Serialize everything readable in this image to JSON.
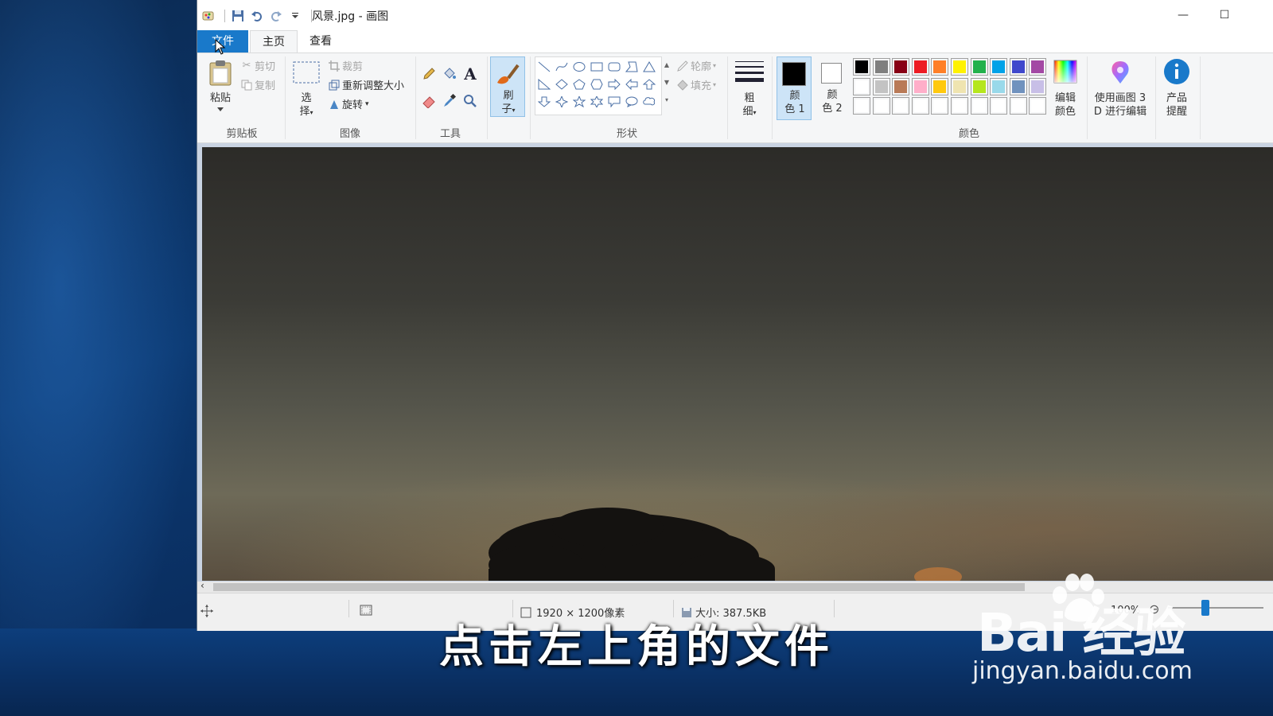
{
  "window": {
    "title": "风景.jpg - 画图",
    "controls": {
      "minimize": "—",
      "maximize": "☐"
    }
  },
  "tabs": [
    {
      "label": "文件",
      "active": true
    },
    {
      "label": "主页"
    },
    {
      "label": "查看"
    }
  ],
  "ribbon": {
    "clipboard": {
      "paste": "粘贴",
      "cut": "剪切",
      "copy": "复制",
      "group": "剪贴板"
    },
    "image": {
      "select_1": "选",
      "select_2": "择",
      "crop": "裁剪",
      "resize": "重新调整大小",
      "rotate": "旋转",
      "group": "图像"
    },
    "tools": {
      "group": "工具"
    },
    "brush": {
      "label_1": "刷",
      "label_2": "子"
    },
    "shapes": {
      "outline": "轮廓",
      "fill": "填充",
      "group": "形状"
    },
    "size": {
      "label_1": "粗",
      "label_2": "细"
    },
    "color1": {
      "label_1": "颜",
      "label_2": "色 1",
      "value": "#000000"
    },
    "color2": {
      "label_1": "颜",
      "label_2": "色 2",
      "value": "#ffffff"
    },
    "colors": {
      "group": "颜色",
      "row1": [
        "#000000",
        "#7f7f7f",
        "#880015",
        "#ed1c24",
        "#ff7f27",
        "#fff200",
        "#22b14c",
        "#00a2e8",
        "#3f48cc",
        "#a349a4"
      ],
      "row2": [
        "#ffffff",
        "#c3c3c3",
        "#b97a57",
        "#ffaec9",
        "#ffc90e",
        "#efe4b0",
        "#b5e61d",
        "#99d9ea",
        "#7092be",
        "#c8bfe7"
      ],
      "row3": [
        "#ffffff",
        "#ffffff",
        "#ffffff",
        "#ffffff",
        "#ffffff",
        "#ffffff",
        "#ffffff",
        "#ffffff",
        "#ffffff",
        "#ffffff"
      ]
    },
    "edit_colors": {
      "label_1": "编辑",
      "label_2": "颜色"
    },
    "paint3d": {
      "label_1": "使用画图 3",
      "label_2": "D 进行编辑"
    },
    "product_alert": {
      "label_1": "产品",
      "label_2": "提醒"
    }
  },
  "status": {
    "dimensions": "1920 × 1200像素",
    "size": "大小: 387.5KB",
    "zoom": "100%"
  },
  "overlay": {
    "subtitle": "点击左上角的文件",
    "watermark_logo": "Bai 经验",
    "watermark_url": "jingyan.baidu.com"
  }
}
